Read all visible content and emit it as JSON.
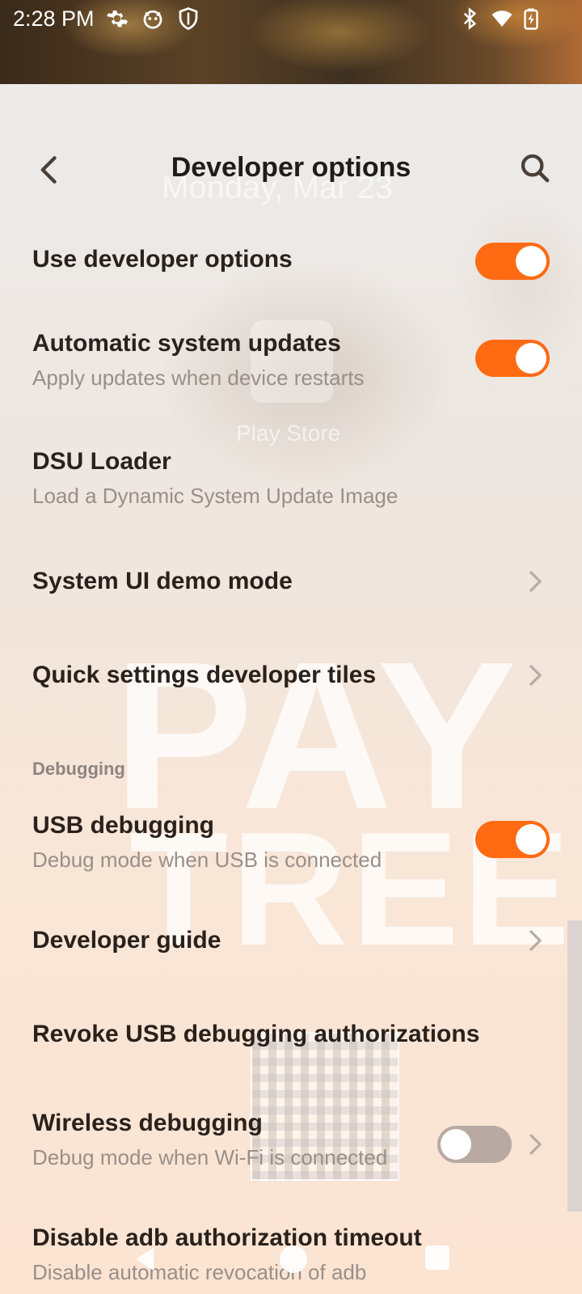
{
  "status_bar": {
    "time": "2:28 PM",
    "left_icons": [
      "gear-icon",
      "face-icon",
      "shield-icon"
    ],
    "right_icons": [
      "bluetooth-icon",
      "wifi-icon",
      "battery-charging-icon"
    ]
  },
  "header": {
    "title": "Developer options",
    "back_icon": "chevron-left-icon",
    "search_icon": "search-icon"
  },
  "background": {
    "date": "Monday, Mar 23",
    "app_label": "Play Store",
    "watermark_1": "PAY",
    "watermark_2": "TREE"
  },
  "settings": {
    "use_developer_options": {
      "title": "Use developer options",
      "enabled": true
    },
    "automatic_updates": {
      "title": "Automatic system updates",
      "subtitle": "Apply updates when device restarts",
      "enabled": true
    },
    "dsu_loader": {
      "title": "DSU Loader",
      "subtitle": "Load a Dynamic System Update Image"
    },
    "system_ui_demo": {
      "title": "System UI demo mode"
    },
    "quick_settings_tiles": {
      "title": "Quick settings developer tiles"
    },
    "debugging_section": "Debugging",
    "usb_debugging": {
      "title": "USB debugging",
      "subtitle": "Debug mode when USB is connected",
      "enabled": true
    },
    "developer_guide": {
      "title": "Developer guide"
    },
    "revoke_usb": {
      "title": "Revoke USB debugging authorizations"
    },
    "wireless_debugging": {
      "title": "Wireless debugging",
      "subtitle": "Debug mode when Wi-Fi is connected",
      "enabled": false
    },
    "disable_adb_timeout": {
      "title": "Disable adb authorization timeout",
      "subtitle": "Disable automatic revocation of adb"
    }
  },
  "colors": {
    "accent": "#ff6a13",
    "toggle_off": "#b8aaa3"
  }
}
